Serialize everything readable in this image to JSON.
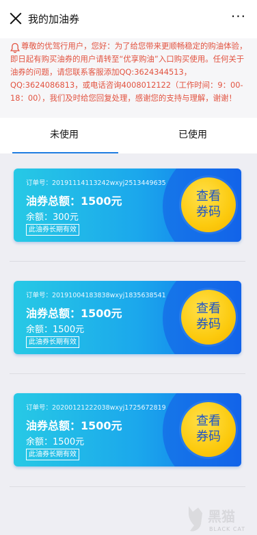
{
  "header": {
    "title": "我的加油券",
    "more": "···"
  },
  "notice": {
    "text": "尊敬的优驾行用户，您好：为了给您带来更顺畅稳定的购油体验，即日起有购买油券的用户请转至“优享购油”入口购买使用。任何关于油券的问题，请您联系客服添加QQ:3624344513，QQ:3624086813，或电话咨询4008012122（工作时间：9：00-18：00），我们及时给您回复处理，感谢您的支持与理解，谢谢！"
  },
  "tabs": [
    "未使用",
    "已使用"
  ],
  "coupons": [
    {
      "order": "订单号：20191114113242wxyj2513449635",
      "total": "油券总额：1500元",
      "balance": "余额：300元",
      "validity": "此油券长期有效",
      "button_line1": "查看",
      "button_line2": "券码"
    },
    {
      "order": "订单号：20191004183838wxyj1835638541",
      "total": "油券总额：1500元",
      "balance": "余额：1500元",
      "validity": "此油券长期有效",
      "button_line1": "查看",
      "button_line2": "券码"
    },
    {
      "order": "订单号：20200121222038wxyj1725672819",
      "total": "油券总额：1500元",
      "balance": "余额：1500元",
      "validity": "此油券长期有效",
      "button_line1": "查看",
      "button_line2": "券码"
    }
  ],
  "watermark": {
    "brand": "黑猫",
    "sub": "BLACK CAT"
  },
  "colors": {
    "accent": "#1e7de1",
    "notice_text": "#e25340",
    "button_yellow": "#fcca0e",
    "button_text": "#1d54c8"
  }
}
